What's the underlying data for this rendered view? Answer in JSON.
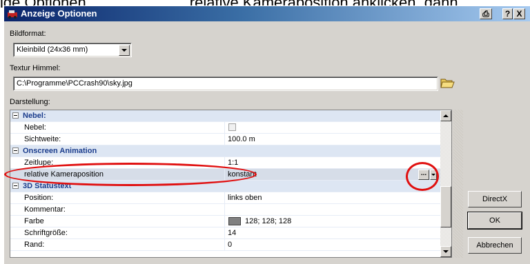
{
  "caption": {
    "left": "ige Optionen",
    "right": "relative Kameraposition anklicken, dann"
  },
  "window": {
    "title": "Anzeige Optionen",
    "buttons": [
      "⎙",
      "?",
      "X"
    ]
  },
  "bildformat": {
    "label": "Bildformat:",
    "value": "Kleinbild (24x36 mm)"
  },
  "textur": {
    "label": "Textur Himmel:",
    "value": "C:\\Programme\\PCCrash90\\sky.jpg"
  },
  "darstellung": {
    "label": "Darstellung:"
  },
  "grid": {
    "rows": [
      {
        "type": "category",
        "name": "Nebel:"
      },
      {
        "type": "prop",
        "name": "Nebel:",
        "value": ""
      },
      {
        "type": "prop",
        "name": "Sichtweite:",
        "value": "100.0 m"
      },
      {
        "type": "category",
        "name": "Onscreen Animation"
      },
      {
        "type": "prop",
        "name": "Zeitlupe:",
        "value": "1:1"
      },
      {
        "type": "prop",
        "name": "relative Kameraposition",
        "value": "konstant",
        "selected": true
      },
      {
        "type": "category",
        "name": "3D Statustext"
      },
      {
        "type": "prop",
        "name": "Position:",
        "value": "links oben"
      },
      {
        "type": "prop",
        "name": "Kommentar:",
        "value": ""
      },
      {
        "type": "prop",
        "name": "Farbe",
        "value": "128; 128; 128"
      },
      {
        "type": "prop",
        "name": "Schriftgröße:",
        "value": "14"
      },
      {
        "type": "prop",
        "name": "Rand:",
        "value": "0"
      }
    ],
    "ellipsis": "..."
  },
  "side_buttons": {
    "directx": "DirectX",
    "ok": "OK",
    "cancel": "Abbrechen"
  },
  "colors": {
    "annotation": "#e01010",
    "titlebar": "#0a246a",
    "category_text": "#1a3c8c"
  }
}
